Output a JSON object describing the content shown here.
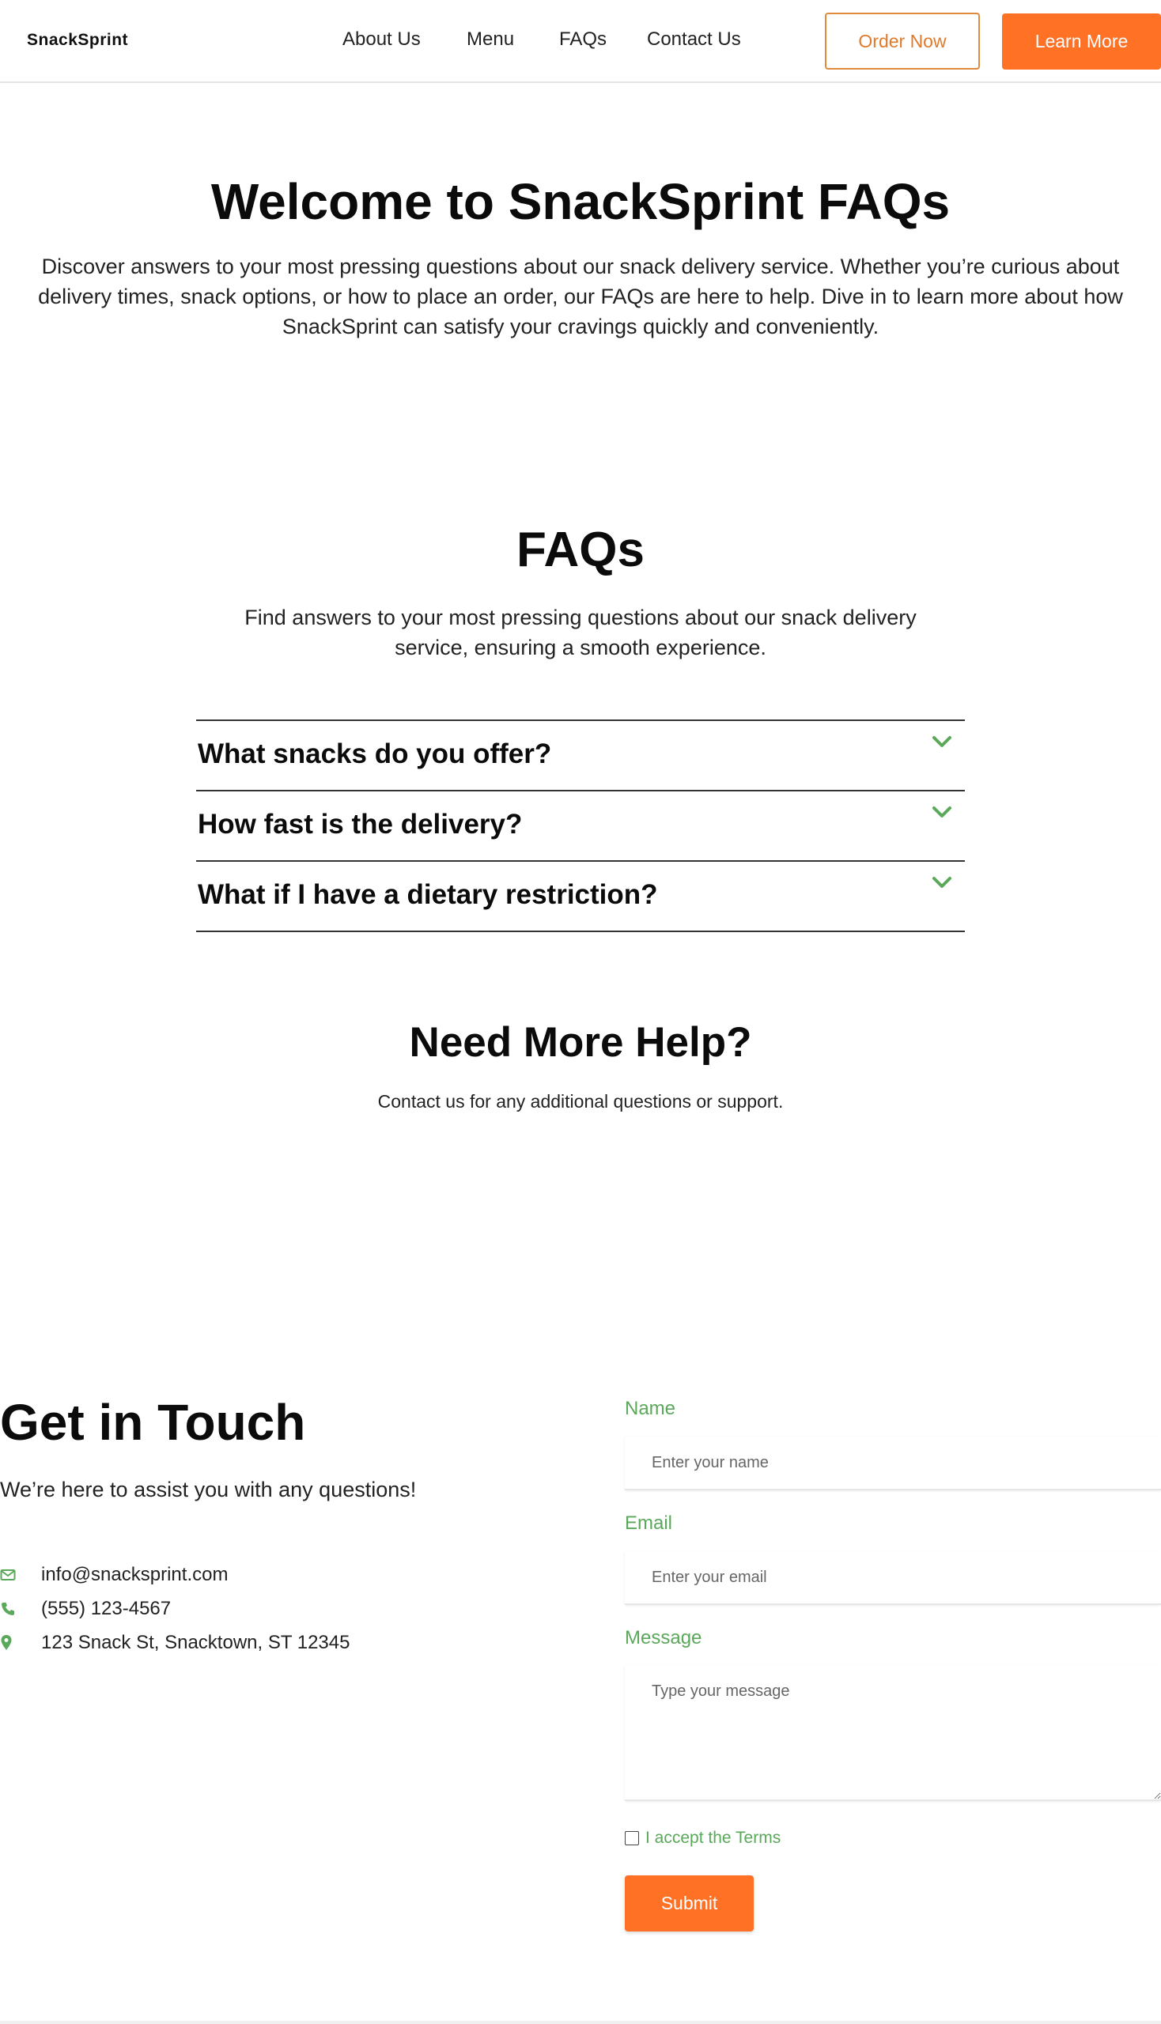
{
  "header": {
    "logo": "SnackSprint",
    "nav": [
      "About Us",
      "Menu",
      "FAQs",
      "Contact Us"
    ],
    "order_button": "Order Now",
    "learn_button": "Learn More",
    "colors": {
      "accent": "#ff7125",
      "outline": "#e08a3c"
    }
  },
  "hero": {
    "title": "Welcome to SnackSprint FAQs",
    "subtitle": "Discover answers to your most pressing questions about our snack delivery service. Whether you’re curious about delivery times, snack options, or how to place an order, our FAQs are here to help. Dive in to learn more about how SnackSprint can satisfy your cravings quickly and conveniently."
  },
  "faq": {
    "title": "FAQs",
    "subtitle": "Find answers to your most pressing questions about our snack delivery service, ensuring a smooth experience.",
    "items": [
      {
        "question": "What snacks do you offer?",
        "icon": "chevron-down-icon"
      },
      {
        "question": "How fast is the delivery?",
        "icon": "chevron-down-icon"
      },
      {
        "question": "What if I have a dietary restriction?",
        "icon": "chevron-down-icon"
      }
    ],
    "chevron_color": "#5aa85a"
  },
  "help": {
    "title": "Need More Help?",
    "subtitle": "Contact us for any additional questions or support."
  },
  "contact": {
    "title": "Get in Touch",
    "subtitle": "We’re here to assist you with any questions!",
    "email": "info@snacksprint.com",
    "phone": "(555) 123-4567",
    "address": "123 Snack St, Snacktown, ST 12345",
    "icons": [
      "envelope-icon",
      "phone-icon",
      "map-pin-icon"
    ],
    "icon_color": "#5aa85a"
  },
  "form": {
    "name_label": "Name",
    "name_placeholder": "Enter your name",
    "email_label": "Email",
    "email_placeholder": "Enter your email",
    "message_label": "Message",
    "message_placeholder": "Type your message",
    "terms_label": "I accept the Terms",
    "terms_checked": false,
    "submit_label": "Submit"
  }
}
